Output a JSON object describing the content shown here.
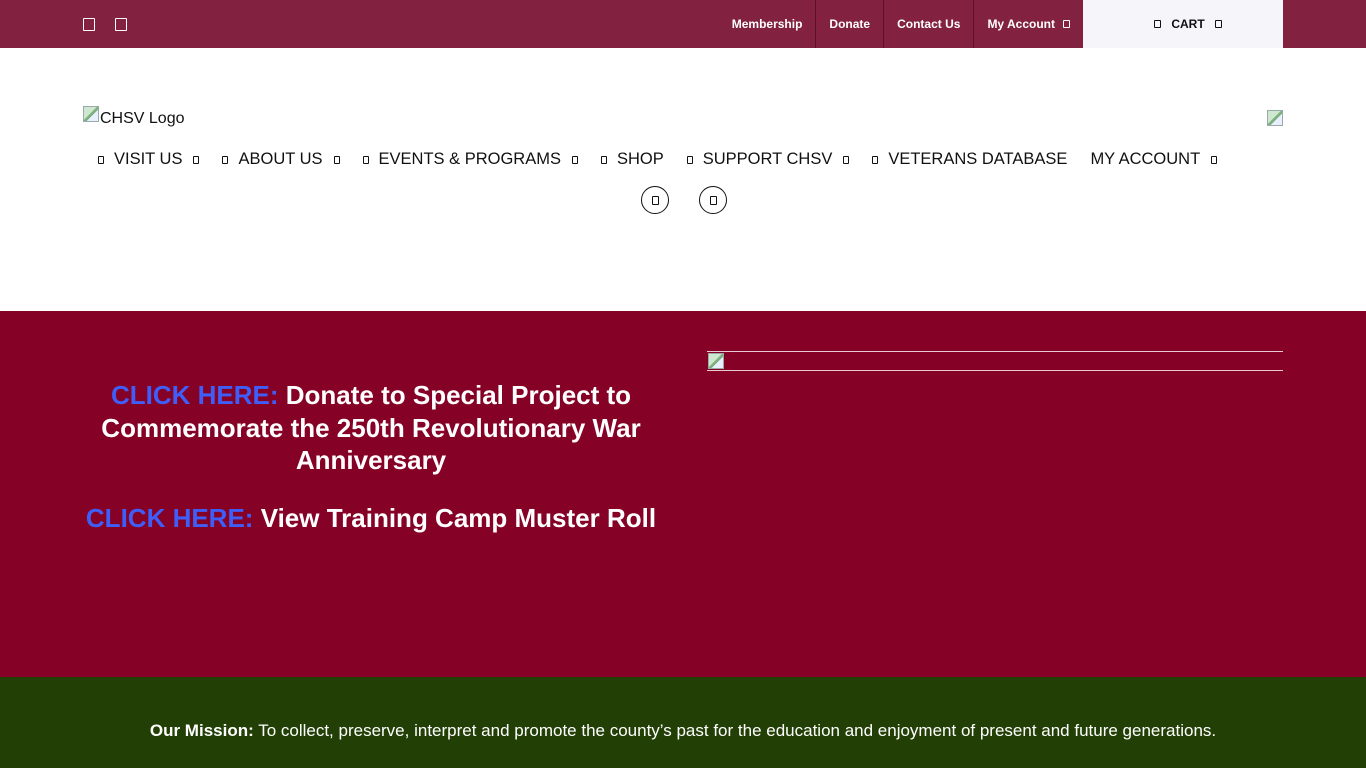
{
  "topbar": {
    "social": [
      {
        "icon": "facebook-icon"
      },
      {
        "icon": "instagram-icon"
      }
    ],
    "links": [
      {
        "label": "Membership"
      },
      {
        "label": "Donate"
      },
      {
        "label": "Contact Us"
      },
      {
        "label": "My Account",
        "has_dropdown": true
      }
    ],
    "cart_label": "CART",
    "colors": {
      "background": "#832240",
      "cart_background": "#f5f5fa"
    }
  },
  "header": {
    "logo_alt": "CHSV Logo",
    "nav": [
      {
        "label": "VISIT US",
        "has_dropdown": true,
        "leading_icon": true
      },
      {
        "label": "ABOUT US",
        "has_dropdown": true,
        "leading_icon": true
      },
      {
        "label": "EVENTS & PROGRAMS",
        "has_dropdown": true,
        "leading_icon": true
      },
      {
        "label": "SHOP",
        "has_dropdown": false,
        "leading_icon": true
      },
      {
        "label": "SUPPORT CHSV",
        "has_dropdown": true,
        "leading_icon": true
      },
      {
        "label": "VETERANS DATABASE",
        "has_dropdown": false,
        "leading_icon": true
      },
      {
        "label": "MY ACCOUNT",
        "has_dropdown": true,
        "leading_icon": false
      }
    ],
    "utility_icons": [
      "search-icon",
      "cart-icon"
    ]
  },
  "hero": {
    "cta1_prefix": "CLICK HERE:",
    "cta1_text": "Donate to Special Project to Commemorate the 250th Revolutionary War Anniversary",
    "cta2_prefix": "CLICK HERE:",
    "cta2_text": "View Training Camp Muster Roll",
    "colors": {
      "background": "#850126",
      "link": "#3f5ef8"
    }
  },
  "mission": {
    "label": "Our Mission:",
    "text": "To collect, preserve, interpret and promote the county’s past for the education and enjoyment of present and future generations.",
    "colors": {
      "background": "#223f05"
    }
  }
}
